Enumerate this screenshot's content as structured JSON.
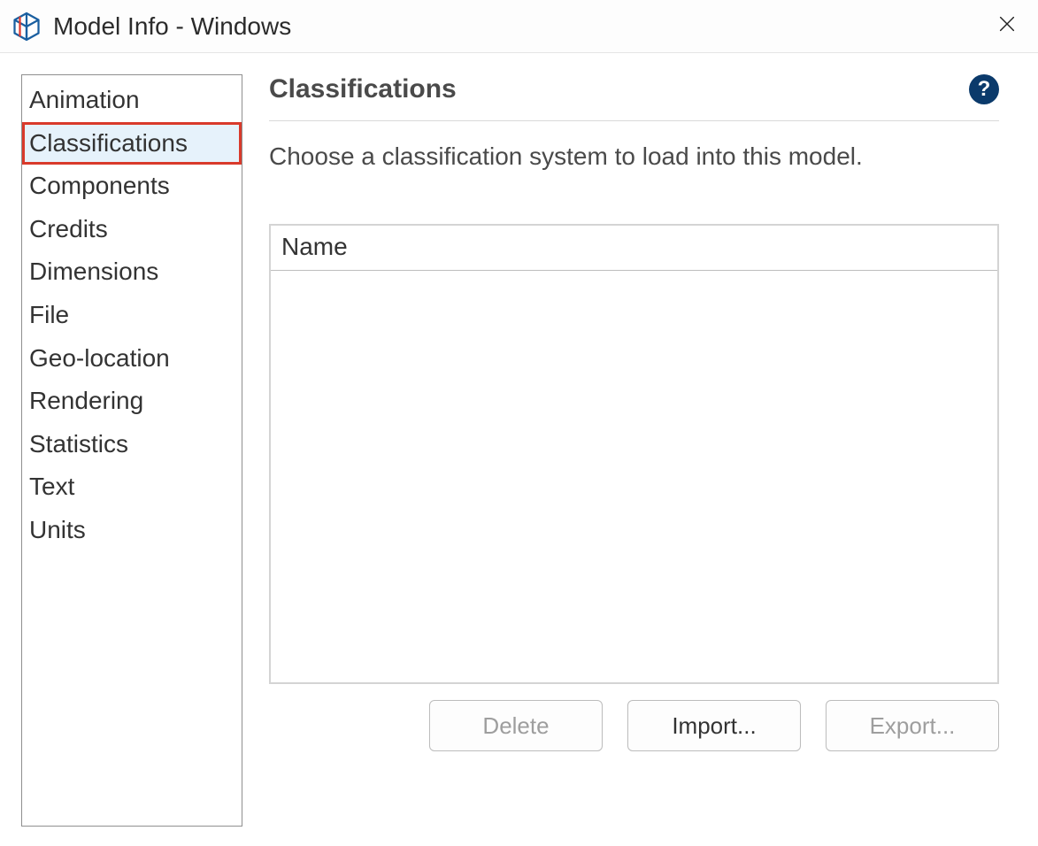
{
  "window": {
    "title": "Model Info - Windows"
  },
  "sidebar": {
    "items": [
      {
        "label": "Animation",
        "selected": false
      },
      {
        "label": "Classifications",
        "selected": true
      },
      {
        "label": "Components",
        "selected": false
      },
      {
        "label": "Credits",
        "selected": false
      },
      {
        "label": "Dimensions",
        "selected": false
      },
      {
        "label": "File",
        "selected": false
      },
      {
        "label": "Geo-location",
        "selected": false
      },
      {
        "label": "Rendering",
        "selected": false
      },
      {
        "label": "Statistics",
        "selected": false
      },
      {
        "label": "Text",
        "selected": false
      },
      {
        "label": "Units",
        "selected": false
      }
    ]
  },
  "main": {
    "panel_title": "Classifications",
    "help_symbol": "?",
    "description": "Choose a classification system to load into this model.",
    "table": {
      "column_header": "Name",
      "rows": []
    },
    "buttons": {
      "delete": "Delete",
      "import": "Import...",
      "export": "Export..."
    }
  }
}
